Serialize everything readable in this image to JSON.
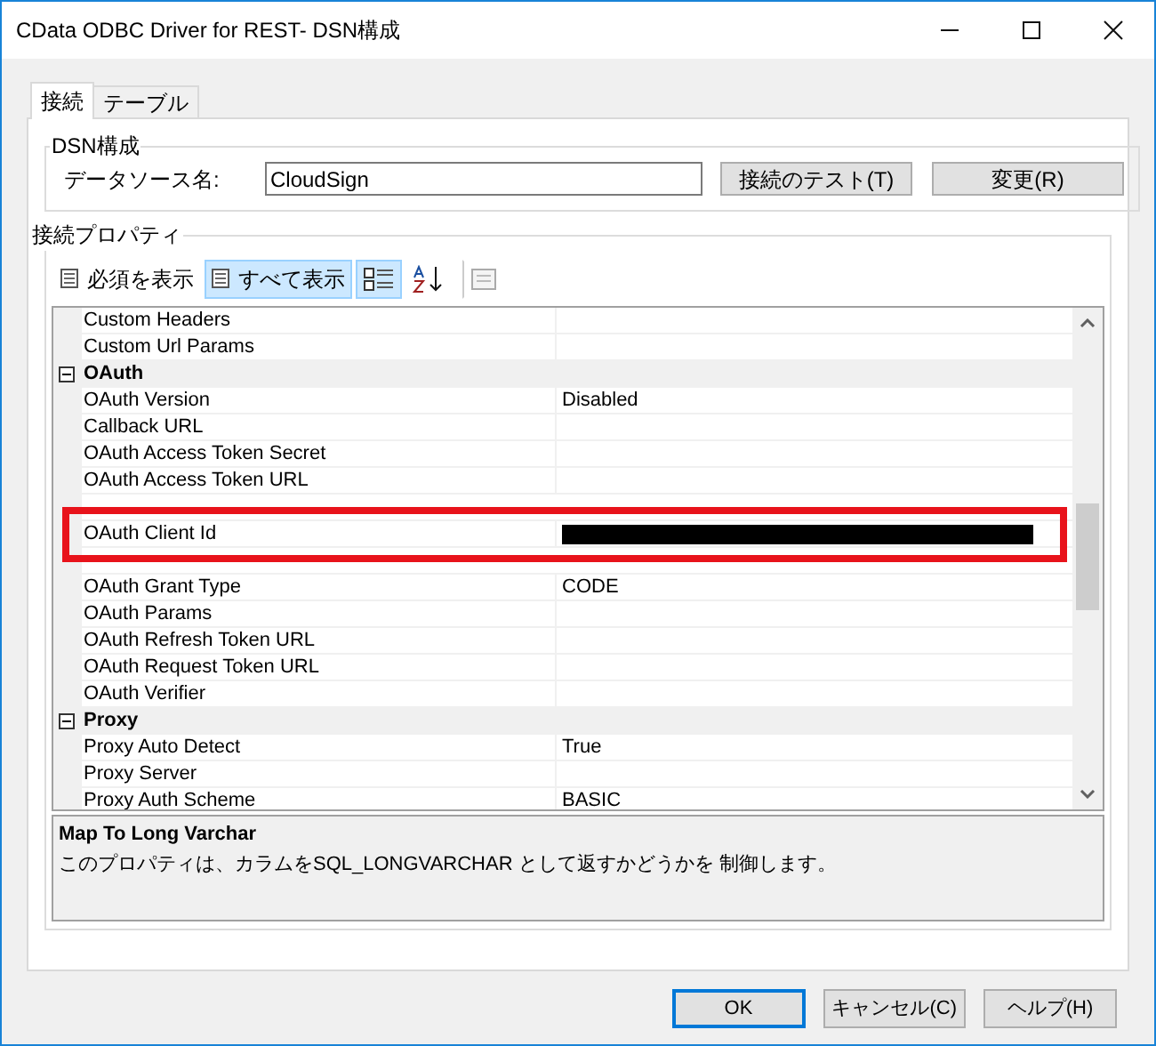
{
  "window": {
    "title": "CData ODBC Driver for REST- DSN構成",
    "controls": [
      {
        "kind": "minimize"
      },
      {
        "kind": "maximize"
      },
      {
        "kind": "close"
      }
    ]
  },
  "tabs": [
    {
      "label": "接続",
      "selected": true
    },
    {
      "label": "テーブル",
      "selected": false
    }
  ],
  "dsn_group": {
    "title": "DSN構成",
    "label": "データソース名:",
    "value": "CloudSign",
    "buttons": [
      "接続のテスト(T)",
      "変更(R)"
    ]
  },
  "properties_group": {
    "title": "接続プロパティ",
    "toolbar": [
      {
        "kind": "text",
        "label": "必須を表示",
        "selected": false
      },
      {
        "kind": "text",
        "label": "すべて表示",
        "selected": true
      },
      {
        "kind": "categorized",
        "selected": true
      },
      {
        "kind": "alphabetical",
        "selected": false
      },
      {
        "kind": "pages",
        "selected": false
      }
    ],
    "rows": [
      {
        "kind": "property",
        "name": "Custom Headers",
        "value": ""
      },
      {
        "kind": "property",
        "name": "Custom Url Params",
        "value": ""
      },
      {
        "kind": "category",
        "name": "OAuth",
        "expanded": true
      },
      {
        "kind": "property",
        "name": "OAuth Version",
        "value": "Disabled"
      },
      {
        "kind": "property",
        "name": "Callback URL",
        "value": ""
      },
      {
        "kind": "property",
        "name": "OAuth Access Token Secret",
        "value": ""
      },
      {
        "kind": "property",
        "name": "OAuth Access Token URL",
        "value": ""
      },
      {
        "kind": "obscured"
      },
      {
        "kind": "property",
        "name": "OAuth Client Id",
        "value": "",
        "redacted": true,
        "highlighted": true
      },
      {
        "kind": "obscured"
      },
      {
        "kind": "property",
        "name": "OAuth Grant Type",
        "value": "CODE"
      },
      {
        "kind": "property",
        "name": "OAuth Params",
        "value": ""
      },
      {
        "kind": "property",
        "name": "OAuth Refresh Token URL",
        "value": ""
      },
      {
        "kind": "property",
        "name": "OAuth Request Token URL",
        "value": ""
      },
      {
        "kind": "property",
        "name": "OAuth Verifier",
        "value": ""
      },
      {
        "kind": "category",
        "name": "Proxy",
        "expanded": true
      },
      {
        "kind": "property",
        "name": "Proxy Auto Detect",
        "value": "True"
      },
      {
        "kind": "property",
        "name": "Proxy Server",
        "value": ""
      },
      {
        "kind": "property",
        "name": "Proxy Auth Scheme",
        "value": "BASIC"
      }
    ],
    "description": {
      "title": "Map To Long Varchar",
      "text": "このプロパティは、カラムをSQL_LONGVARCHAR として返すかどうかを 制御します。"
    }
  },
  "buttons": [
    {
      "label": "OK",
      "default": true
    },
    {
      "label": "キャンセル(C)",
      "default": false
    },
    {
      "label": "ヘルプ(H)",
      "default": false
    }
  ]
}
